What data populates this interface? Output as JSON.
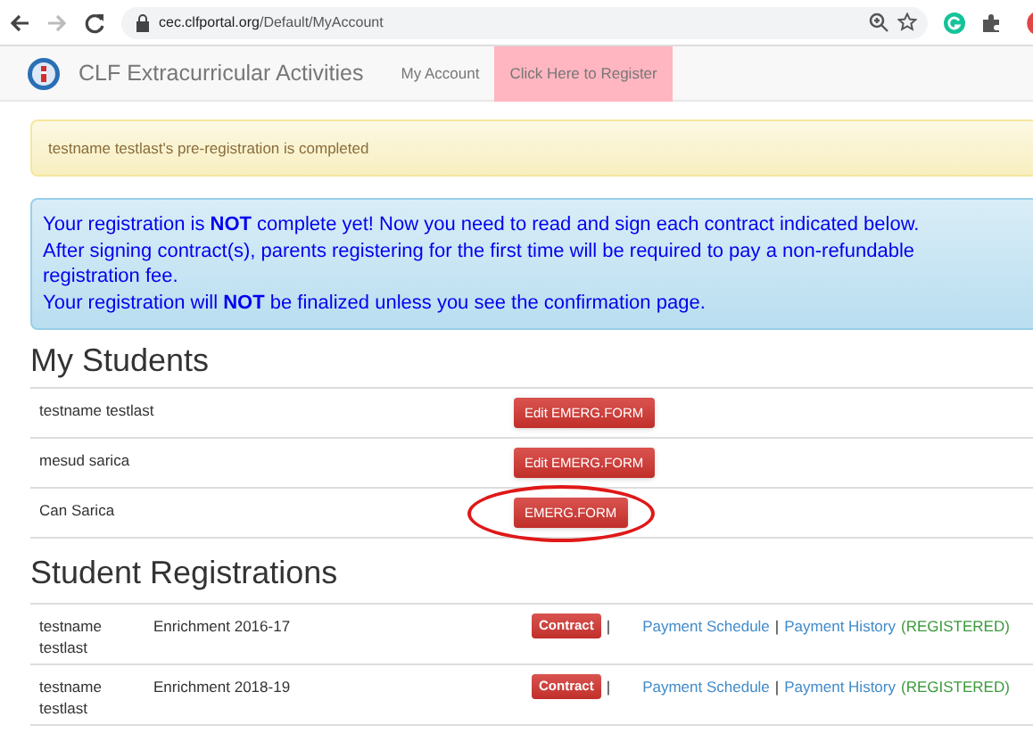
{
  "browser": {
    "url_host": "cec.clfportal.org",
    "url_path": "/Default/MyAccount",
    "forward_disabled": true
  },
  "navbar": {
    "brand": "CLF Extracurricular Activities",
    "links": [
      {
        "label": "My Account",
        "highlighted": false
      },
      {
        "label": "Click Here to Register",
        "highlighted": true
      }
    ]
  },
  "success_alert": "testname testlast's pre-registration is completed",
  "info_alert": [
    "Your registration is **NOT** complete yet! Now you need to read and sign each contract indicated below.",
    "After signing contract(s), parents registering for the first time will be required to pay a non-refundable registration fee.",
    "Your registration will **NOT** be finalized unless you see the confirmation page."
  ],
  "students_heading": "My Students",
  "students": [
    {
      "name": "testname testlast",
      "button": "Edit EMERG.FORM",
      "circled": false
    },
    {
      "name": "mesud sarica",
      "button": "Edit EMERG.FORM",
      "circled": false
    },
    {
      "name": "Can Sarica",
      "button": "EMERG.FORM",
      "circled": true
    }
  ],
  "registrations_heading": "Student Registrations",
  "registrations": [
    {
      "student": "testname testlast",
      "program": "Enrichment 2016-17",
      "contract": "Contract",
      "separator": "|",
      "links": [
        {
          "kind": "link",
          "text": "Payment Schedule"
        },
        {
          "kind": "separator",
          "text": "|"
        },
        {
          "kind": "link",
          "text": "Payment History"
        },
        {
          "kind": "status",
          "text": "(REGISTERED)"
        }
      ]
    },
    {
      "student": "testname testlast",
      "program": "Enrichment 2018-19",
      "contract": "Contract",
      "separator": "|",
      "links": [
        {
          "kind": "link",
          "text": "Payment Schedule"
        },
        {
          "kind": "separator",
          "text": "|"
        },
        {
          "kind": "link",
          "text": "Payment History"
        },
        {
          "kind": "status",
          "text": "(REGISTERED)"
        }
      ]
    }
  ]
}
